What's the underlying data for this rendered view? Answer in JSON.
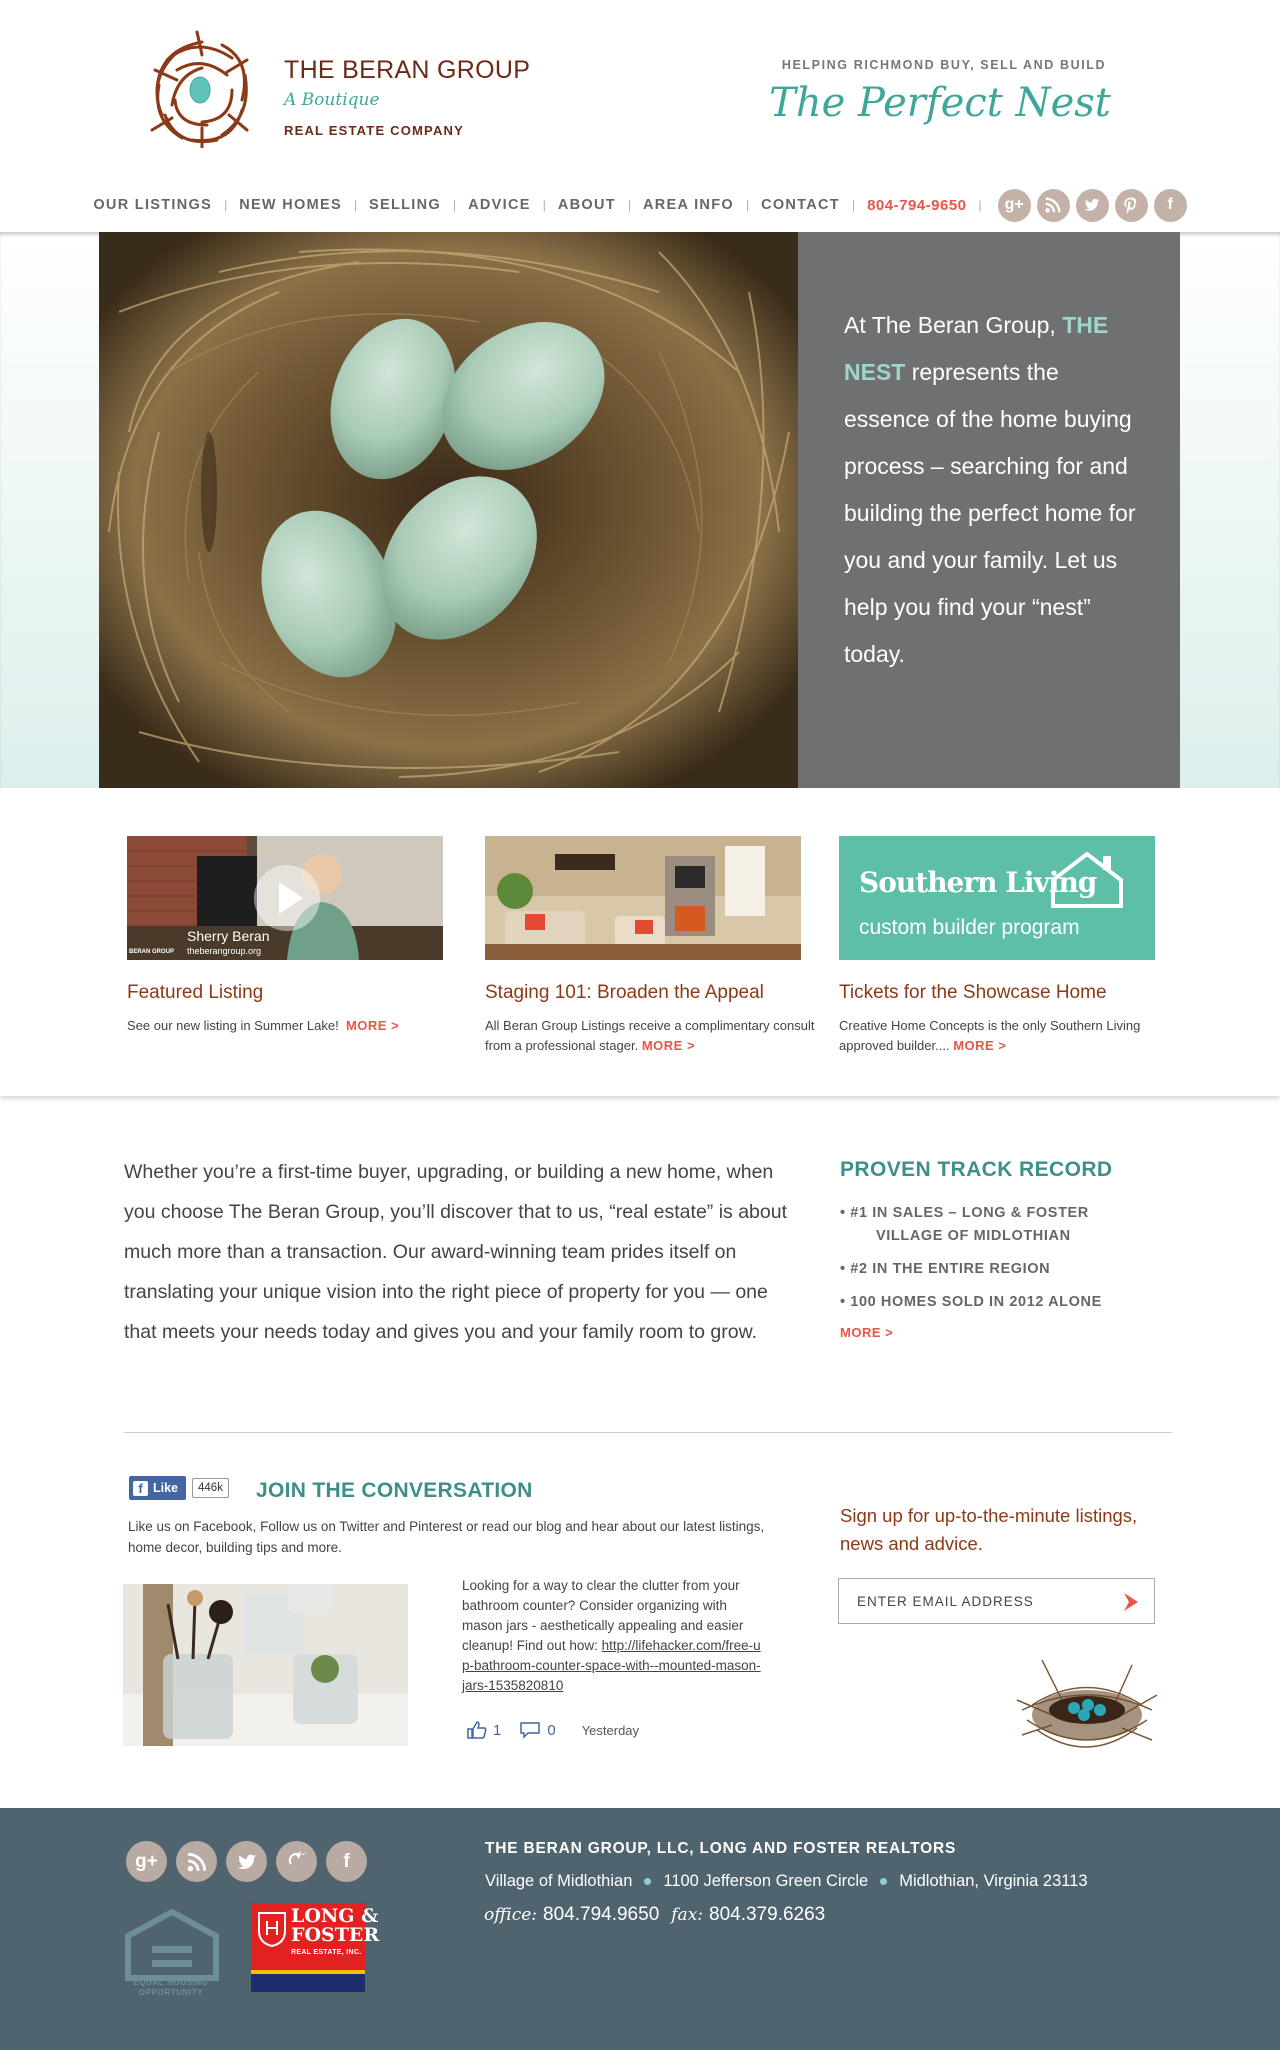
{
  "brand": {
    "name": "THE BERAN GROUP",
    "sub1": "A Boutique",
    "sub2": "REAL ESTATE COMPANY",
    "tagline": "HELPING RICHMOND BUY, SELL AND BUILD",
    "script": "The Perfect Nest"
  },
  "nav": {
    "items": [
      "OUR LISTINGS",
      "NEW HOMES",
      "SELLING",
      "ADVICE",
      "ABOUT",
      "AREA INFO",
      "CONTACT"
    ],
    "phone": "804-794-9650",
    "sep": "|"
  },
  "social_icons": [
    "google-plus-icon",
    "rss-icon",
    "twitter-icon",
    "pinterest-icon",
    "facebook-icon"
  ],
  "hero": {
    "line1": "At The Beran Group,",
    "accent": "THE NEST",
    "line2": "represents the essence of the home buying process – searching for and building the perfect home for you and your family. Let us help you find your “nest” today."
  },
  "features": [
    {
      "title": "Featured Listing",
      "desc": "See our new listing in Summer Lake!",
      "more": "MORE >",
      "video_name": "Sherry Beran",
      "video_site": "theberangroup.org",
      "video_brand": "BERAN GROUP"
    },
    {
      "title": "Staging 101: Broaden the Appeal",
      "desc": "All Beran Group Listings receive a complimentary consult from a professional stager.",
      "more": "MORE >"
    },
    {
      "title": "Tickets for the Showcase Home",
      "desc": "Creative Home Concepts is the only Southern Living approved builder....",
      "more": "MORE >",
      "logo_line1": "Southern Living",
      "logo_line2": "custom builder program"
    }
  ],
  "intro": "Whether you’re a first-time buyer, upgrading, or building a new home, when you choose The Beran Group, you’ll discover that to us, “real estate” is about much more than a transaction. Our award-winning team prides itself on translating your unique vision into the right piece of property for you — one that meets your needs today and gives you and your family room to grow.",
  "track_record": {
    "title": "PROVEN TRACK RECORD",
    "item1a": "• #1 IN SALES – LONG & FOSTER",
    "item1b": "VILLAGE OF MIDLOTHIAN",
    "item2": "• #2 IN THE ENTIRE REGION",
    "item3": "• 100 HOMES SOLD IN 2012 ALONE",
    "more": "MORE >"
  },
  "conversation": {
    "like_label": "Like",
    "like_count": "446k",
    "title": "JOIN THE CONVERSATION",
    "desc": "Like us on Facebook, Follow us on Twitter and Pinterest or read our blog and hear about our latest listings, home decor, building tips and more.",
    "post_text": "Looking for a way to clear the clutter from your bathroom counter? Consider organizing with mason jars - aesthetically appealing and easier cleanup! Find out how:",
    "post_link": "http://lifehacker.com/free-up-bathroom-counter-space-with--mounted-mason-jars-1535820810",
    "likes": "1",
    "comments": "0",
    "when": "Yesterday"
  },
  "signup": {
    "text": "Sign up for up-to-the-minute listings, news and advice.",
    "placeholder": "ENTER EMAIL ADDRESS"
  },
  "footer": {
    "company": "THE BERAN GROUP, LLC, LONG AND FOSTER REALTORS",
    "addr1": "Village of Midlothian",
    "addr2": "1100 Jefferson Green Circle",
    "addr3": "Midlothian, Virginia 23113",
    "office_label": "office:",
    "office": "804.794.9650",
    "fax_label": "fax:",
    "fax": "804.379.6263",
    "eho_line1": "EQUAL HOUSING",
    "eho_line2": "OPPORTUNITY",
    "lf_line1": "LONG &",
    "lf_line2": "FOSTER",
    "lf_line3": "REAL ESTATE, INC."
  },
  "colors": {
    "brand_brown": "#6b2b16",
    "teal": "#3fa69a",
    "accent_red": "#e8564a",
    "hero_panel": "#6f7072",
    "footer_bg": "#4f646e"
  }
}
